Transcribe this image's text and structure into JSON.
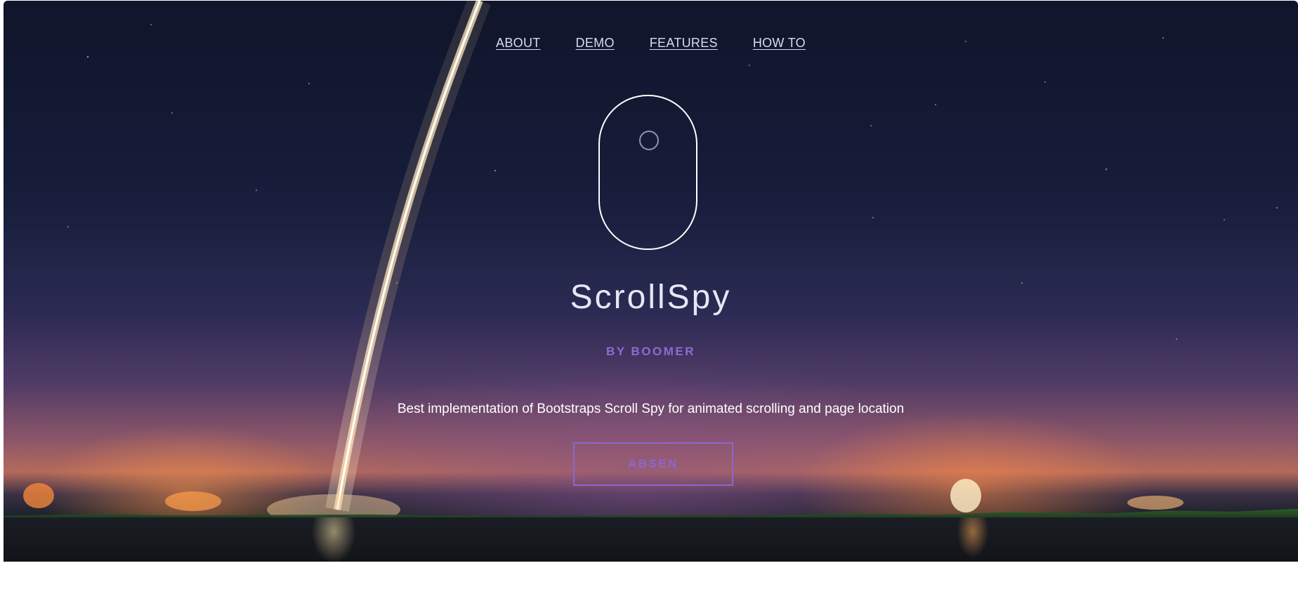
{
  "nav": {
    "items": [
      {
        "label": "ABOUT"
      },
      {
        "label": "DEMO"
      },
      {
        "label": "FEATURES"
      },
      {
        "label": "HOW TO"
      }
    ]
  },
  "hero": {
    "title": "ScrollSpy",
    "subtitle": "BY BOOMER",
    "description": "Best implementation of Bootstraps Scroll Spy for animated scrolling and page location",
    "button_label": "ABSEN"
  },
  "colors": {
    "accent": "#8a67d0",
    "nav_text": "#d8dcf0",
    "title_text": "#e6e6f5"
  },
  "icons": {
    "scroll_indicator": "mouse-scroll-icon"
  }
}
